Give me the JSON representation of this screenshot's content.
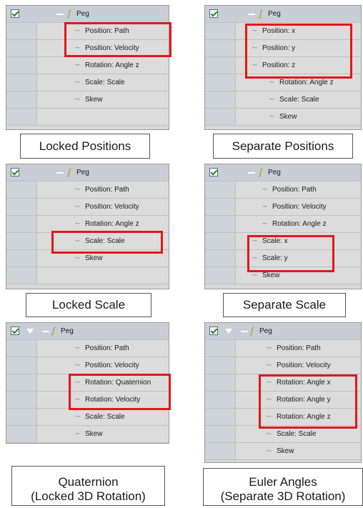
{
  "peg_label": "Peg",
  "captions": {
    "locked_positions": "Locked Positions",
    "separate_positions": "Separate Positions",
    "locked_scale": "Locked Scale",
    "separate_scale": "Separate Scale",
    "quaternion_line1": "Quaternion",
    "quaternion_line2": "(Locked 3D Rotation)",
    "euler_line1": "Euler Angles",
    "euler_line2": "(Separate 3D Rotation)"
  },
  "panel1": {
    "rows": [
      "Position: Path",
      "Position: Velocity",
      "Rotation: Angle z",
      "Scale: Scale",
      "Skew"
    ]
  },
  "panel2": {
    "rows": [
      "Position: x",
      "Position: y",
      "Position: z",
      "Rotation: Angle z",
      "Scale: Scale",
      "Skew"
    ]
  },
  "panel3": {
    "rows": [
      "Position: Path",
      "Position: Velocity",
      "Rotation: Angle z",
      "Scale: Scale",
      "Skew"
    ]
  },
  "panel4": {
    "rows": [
      "Position: Path",
      "Position: Velocity",
      "Rotation: Angle z",
      "Scale: x",
      "Scale: y",
      "Skew"
    ]
  },
  "panel5": {
    "rows": [
      "Position: Path",
      "Position: Velocity",
      "Rotation: Quaternion",
      "Rotation: Velocity",
      "Scale: Scale",
      "Skew"
    ]
  },
  "panel6": {
    "rows": [
      "Position: Path",
      "Position: Velocity",
      "Rotation: Angle x",
      "Rotation: Angle y",
      "Rotation: Angle z",
      "Scale: Scale",
      "Skew"
    ]
  },
  "colors": {
    "highlight": "#e3161c",
    "peg_icon": "#b89000",
    "checkmark": "#1f8a1f"
  },
  "icons": {
    "enable": "checkbox-checked-icon",
    "expand": "triangle-down-icon",
    "peg": "peg-function-icon",
    "function": "function-curve-icon"
  }
}
